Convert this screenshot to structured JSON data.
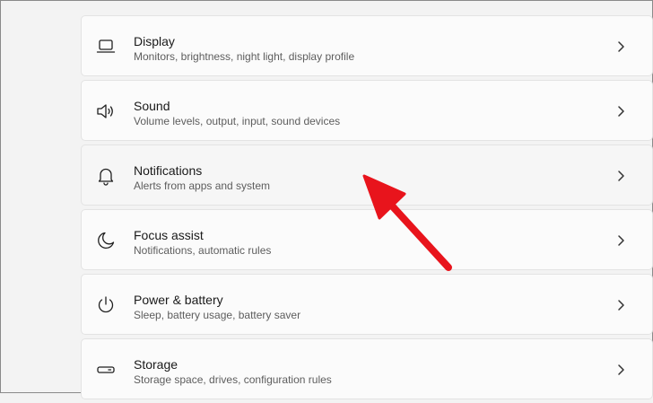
{
  "settings": [
    {
      "title": "Display",
      "subtitle": "Monitors, brightness, night light, display profile",
      "icon": "display-icon"
    },
    {
      "title": "Sound",
      "subtitle": "Volume levels, output, input, sound devices",
      "icon": "speaker-icon"
    },
    {
      "title": "Notifications",
      "subtitle": "Alerts from apps and system",
      "icon": "bell-icon"
    },
    {
      "title": "Focus assist",
      "subtitle": "Notifications, automatic rules",
      "icon": "moon-icon"
    },
    {
      "title": "Power & battery",
      "subtitle": "Sleep, battery usage, battery saver",
      "icon": "power-icon"
    },
    {
      "title": "Storage",
      "subtitle": "Storage space, drives, configuration rules",
      "icon": "drive-icon"
    }
  ],
  "chevron_icon": "chevron-right-icon",
  "annotation": {
    "icon": "red-arrow-icon",
    "color": "#e8141c",
    "points_to": "Notifications"
  },
  "colors": {
    "background": "#f3f3f3",
    "card": "#fbfbfb",
    "card_hover": "#f6f6f6",
    "title_text": "#1a1a1a",
    "subtitle_text": "#5d5d5d",
    "arrow": "#e8141c"
  }
}
